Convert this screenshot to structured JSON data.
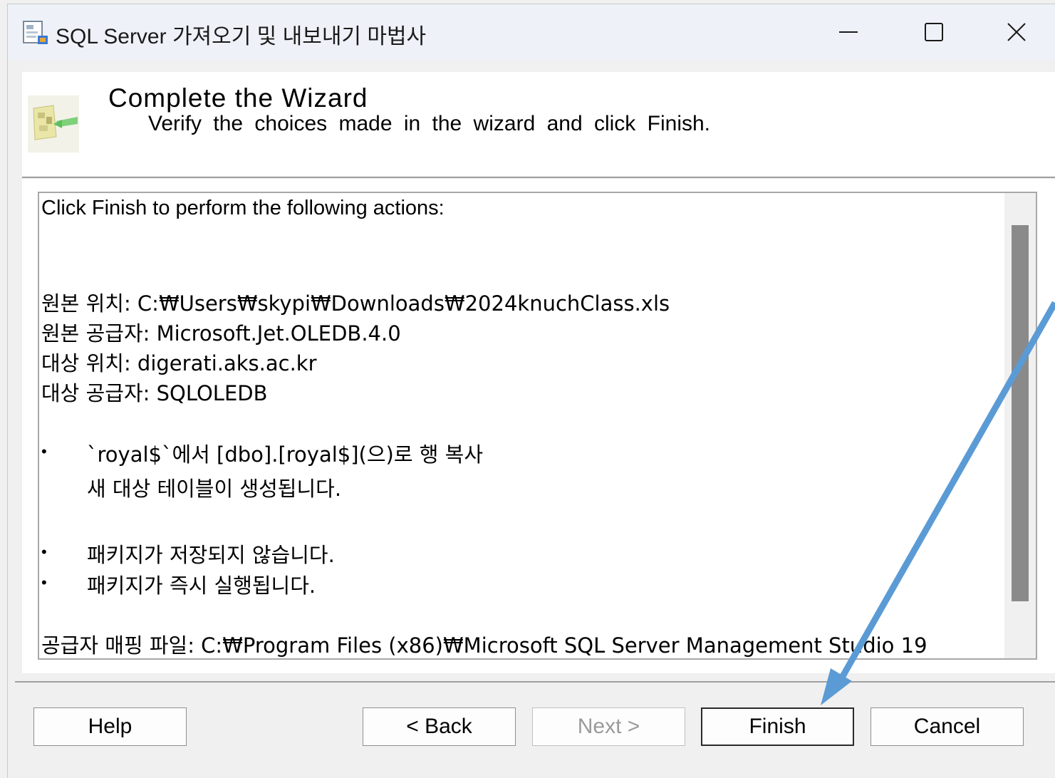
{
  "window": {
    "title": "SQL Server 가져오기 및 내보내기 마법사",
    "controls": {
      "minimize": "—",
      "maximize": "☐",
      "close": "✕"
    }
  },
  "header": {
    "title": "Complete the Wizard",
    "subtitle": "Verify the choices made in the wizard and click Finish."
  },
  "report": {
    "intro": "Click Finish to perform the following actions:",
    "source_location": "원본 위치: C:₩Users₩skypi₩Downloads₩2024knuchClass.xls",
    "source_provider": "원본 공급자: Microsoft.Jet.OLEDB.4.0",
    "dest_location": "대상 위치: digerati.aks.ac.kr",
    "dest_provider": "대상 공급자: SQLOLEDB",
    "bullets": [
      {
        "text": "`royal$`에서 [dbo].[royal$](으)로 행 복사",
        "sub": "새 대상 테이블이 생성됩니다."
      },
      {
        "text": "패키지가 저장되지 않습니다."
      },
      {
        "text": "패키지가 즉시 실행됩니다."
      }
    ],
    "mapping_file": "공급자 매핑 파일: C:₩Program Files (x86)₩Microsoft SQL Server Management Studio 19",
    "bullet_glyph": "•"
  },
  "buttons": {
    "help": "Help",
    "back": "< Back",
    "next": "Next >",
    "finish": "Finish",
    "cancel": "Cancel"
  },
  "colors": {
    "annotation_arrow": "#5b9bd5",
    "titlebar": "#eef2f8"
  },
  "icons": {
    "app": "wizard-app-icon",
    "header": "wizard-header-icon"
  }
}
